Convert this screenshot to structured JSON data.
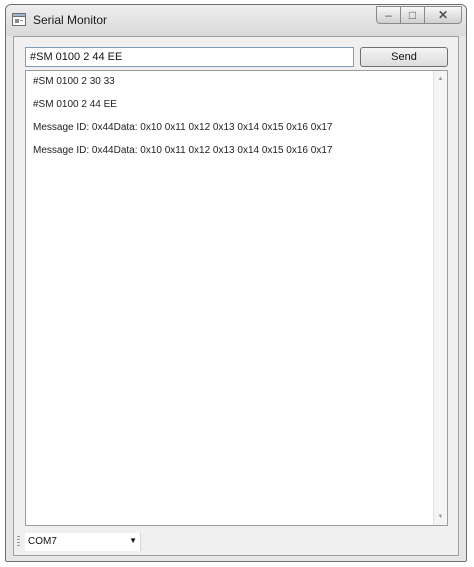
{
  "window": {
    "title": "Serial Monitor",
    "controls": {
      "minimize": "–",
      "maximize": "□",
      "close": "✕"
    }
  },
  "command": {
    "value": "#SM 0100 2 44 EE",
    "send_label": "Send"
  },
  "output": {
    "lines": [
      "#SM 0100 2 30 33",
      "#SM 0100 2 44 EE",
      "Message ID: 0x44Data: 0x10 0x11 0x12 0x13 0x14 0x15 0x16 0x17",
      "Message ID: 0x44Data: 0x10 0x11 0x12 0x13 0x14 0x15 0x16 0x17"
    ]
  },
  "status": {
    "port": "COM7",
    "port_arrow": "▼"
  },
  "icons": {
    "app": "serial-monitor-app-icon",
    "scroll_up": "▲",
    "scroll_down": "▼"
  }
}
